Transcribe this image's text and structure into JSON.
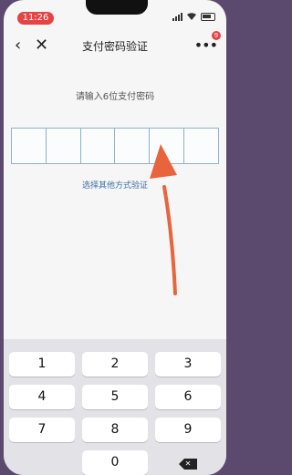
{
  "status_bar": {
    "time": "11:26"
  },
  "nav": {
    "back_icon": "‹",
    "close_icon": "✕",
    "title": "支付密码验证",
    "more_icon": "•••",
    "badge_count": "9"
  },
  "prompt": "请输入6位支付密码",
  "pin": {
    "length": 6
  },
  "other_method_link": "选择其他方式验证",
  "keypad": {
    "keys": [
      "1",
      "2",
      "3",
      "4",
      "5",
      "6",
      "7",
      "8",
      "9",
      "0"
    ],
    "delete_icon": "delete-icon"
  },
  "colors": {
    "accent": "#e64343",
    "link": "#3c6ea6",
    "pin_border": "#8fb3c6",
    "annotation_arrow": "#e8643c"
  }
}
